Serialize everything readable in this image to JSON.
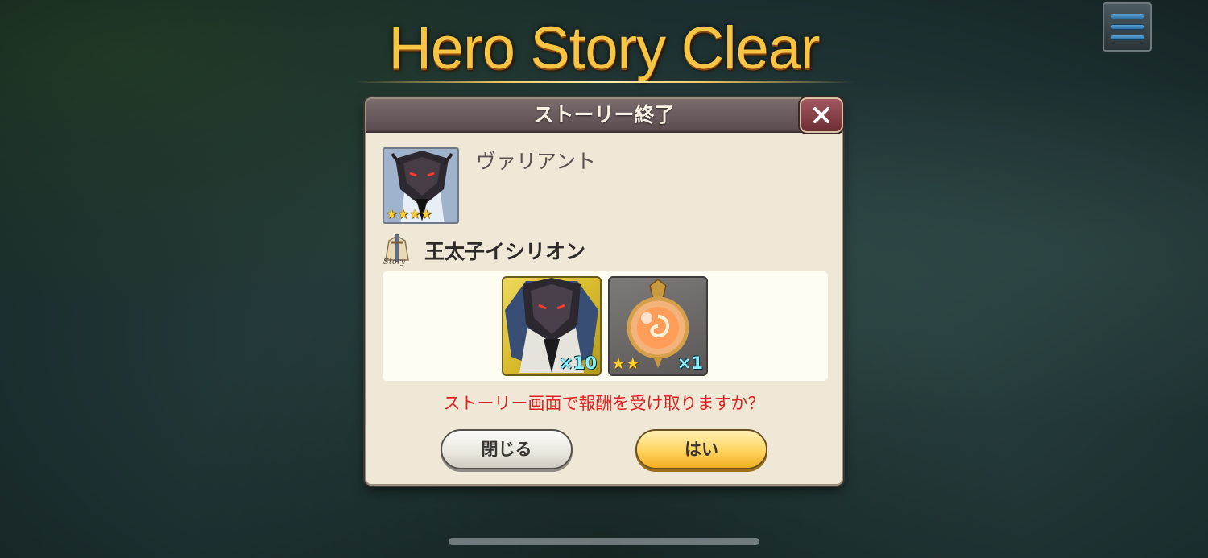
{
  "banner": {
    "title": "Hero Story Clear"
  },
  "menu": {
    "icon": "hamburger-menu-icon"
  },
  "dialog": {
    "title": "ストーリー終了",
    "close_icon": "close-icon",
    "hero": {
      "name": "ヴァリアント",
      "stars": "★★★★",
      "rarity": 4
    },
    "story": {
      "icon": "story-icon",
      "icon_text": "Story",
      "title": "王太子イシリオン"
    },
    "rewards": [
      {
        "icon": "hero-shard-icon",
        "quantity": "×10",
        "stars": ""
      },
      {
        "icon": "orb-icon",
        "quantity": "×1",
        "stars": "★★",
        "rarity": 2
      }
    ],
    "question": "ストーリー画面で報酬を受け取りますか？",
    "buttons": {
      "close_label": "閉じる",
      "yes_label": "はい"
    }
  },
  "colors": {
    "banner_gold": "#f7c544",
    "header_bg": "#5b4d4f",
    "dialog_bg": "#efe8d7",
    "question_red": "#e02020",
    "quantity_cyan": "#8ef0ff",
    "yes_button": "#ffd45e"
  }
}
